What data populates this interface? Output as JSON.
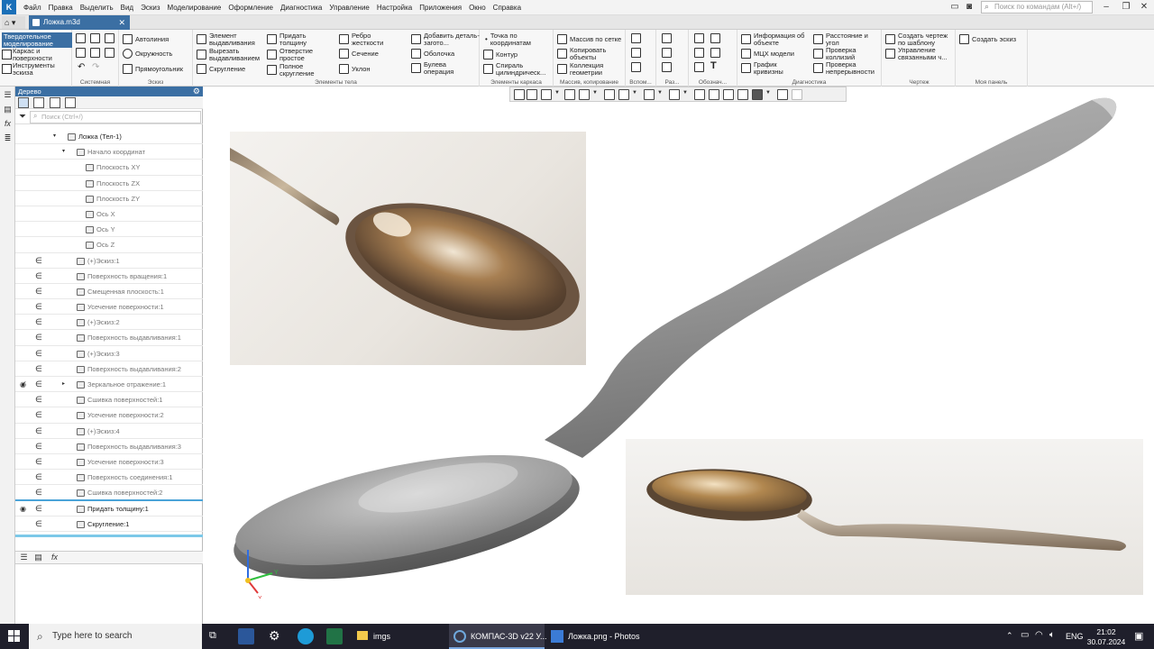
{
  "menu": [
    "Файл",
    "Правка",
    "Выделить",
    "Вид",
    "Эскиз",
    "Моделирование",
    "Оформление",
    "Диагностика",
    "Управление",
    "Настройка",
    "Приложения",
    "Окно",
    "Справка"
  ],
  "command_search_placeholder": "Поиск по командам (Alt+/)",
  "doc_tab": "Ложка.m3d",
  "ribbon": {
    "modes": [
      "Твердотельное моделирование",
      "Каркас и поверхности",
      "Инструменты эскиза"
    ],
    "system": {
      "label": "Системная"
    },
    "sketch": {
      "label": "Эскиз",
      "items": [
        "Автолиния",
        "Окружность",
        "Прямоугольник"
      ]
    },
    "body": {
      "label": "Элементы тела",
      "items": [
        "Элемент выдавливания",
        "Вырезать выдавливанием",
        "Скругление",
        "Придать толщину",
        "Отверстие простое",
        "Полное скругление",
        "Ребро жесткости",
        "Сечение",
        "Уклон",
        "Добавить деталь-загото...",
        "Оболочка",
        "Булева операция"
      ]
    },
    "frame": {
      "label": "Элементы каркаса",
      "items": [
        "Точка по координатам",
        "Контур",
        "Спираль цилиндрическ..."
      ]
    },
    "arrays": {
      "label": "Массив, копирование",
      "items": [
        "Массив по сетке",
        "Копировать объекты",
        "Коллекция геометрии"
      ]
    },
    "aux": {
      "label": "Вспом..."
    },
    "sizes": {
      "label": "Раз..."
    },
    "marks": {
      "label": "Обознач..."
    },
    "diag": {
      "label": "Диагностика",
      "items": [
        "Информация об объекте",
        "МЦХ модели",
        "График кривизны",
        "Расстояние и угол",
        "Проверка коллизий",
        "Проверка непрерывности"
      ]
    },
    "drawing": {
      "label": "Чертеж",
      "items": [
        "Создать чертеж по шаблону",
        "Управление связанными ч..."
      ]
    },
    "mypanel": {
      "label": "Моя панель",
      "items": [
        "Создать эскиз"
      ]
    }
  },
  "tree": {
    "title": "Дерево",
    "search_placeholder": "Поиск (Ctrl+/)",
    "rows": [
      {
        "label": "Ложка (Тел-1)",
        "indent": 0,
        "arrow": "▾",
        "faded": false,
        "eye": "",
        "dep": ""
      },
      {
        "label": "Начало координат",
        "indent": 1,
        "arrow": "▾",
        "faded": true,
        "eye": "",
        "dep": ""
      },
      {
        "label": "Плоскость XY",
        "indent": 2,
        "arrow": "",
        "faded": true,
        "eye": "",
        "dep": ""
      },
      {
        "label": "Плоскость ZX",
        "indent": 2,
        "arrow": "",
        "faded": true,
        "eye": "",
        "dep": ""
      },
      {
        "label": "Плоскость ZY",
        "indent": 2,
        "arrow": "",
        "faded": true,
        "eye": "",
        "dep": ""
      },
      {
        "label": "Ось X",
        "indent": 2,
        "arrow": "",
        "faded": true,
        "eye": "",
        "dep": ""
      },
      {
        "label": "Ось Y",
        "indent": 2,
        "arrow": "",
        "faded": true,
        "eye": "",
        "dep": ""
      },
      {
        "label": "Ось Z",
        "indent": 2,
        "arrow": "",
        "faded": true,
        "eye": "",
        "dep": ""
      },
      {
        "label": "(+)Эскиз:1",
        "indent": 1,
        "arrow": "",
        "faded": true,
        "eye": "",
        "dep": "∈"
      },
      {
        "label": "Поверхность вращения:1",
        "indent": 1,
        "arrow": "",
        "faded": true,
        "eye": "",
        "dep": "∈"
      },
      {
        "label": "Смещенная плоскость:1",
        "indent": 1,
        "arrow": "",
        "faded": true,
        "eye": "",
        "dep": "∈"
      },
      {
        "label": "Усечение поверхности:1",
        "indent": 1,
        "arrow": "",
        "faded": true,
        "eye": "",
        "dep": "∈"
      },
      {
        "label": "(+)Эскиз:2",
        "indent": 1,
        "arrow": "",
        "faded": true,
        "eye": "",
        "dep": "∈"
      },
      {
        "label": "Поверхность выдавливания:1",
        "indent": 1,
        "arrow": "",
        "faded": true,
        "eye": "",
        "dep": "∈"
      },
      {
        "label": "(+)Эскиз:3",
        "indent": 1,
        "arrow": "",
        "faded": true,
        "eye": "",
        "dep": "∈"
      },
      {
        "label": "Поверхность выдавливания:2",
        "indent": 1,
        "arrow": "",
        "faded": true,
        "eye": "",
        "dep": "∈"
      },
      {
        "label": "Зеркальное отражение:1",
        "indent": 1,
        "arrow": "▸",
        "faded": true,
        "eye": "◉̸",
        "dep": "∈"
      },
      {
        "label": "Сшивка поверхностей:1",
        "indent": 1,
        "arrow": "",
        "faded": true,
        "eye": "",
        "dep": "∈"
      },
      {
        "label": "Усечение поверхности:2",
        "indent": 1,
        "arrow": "",
        "faded": true,
        "eye": "",
        "dep": "∈"
      },
      {
        "label": "(+)Эскиз:4",
        "indent": 1,
        "arrow": "",
        "faded": true,
        "eye": "",
        "dep": "∈"
      },
      {
        "label": "Поверхность выдавливания:3",
        "indent": 1,
        "arrow": "",
        "faded": true,
        "eye": "",
        "dep": "∈"
      },
      {
        "label": "Усечение поверхности:3",
        "indent": 1,
        "arrow": "",
        "faded": true,
        "eye": "",
        "dep": "∈"
      },
      {
        "label": "Поверхность соединения:1",
        "indent": 1,
        "arrow": "",
        "faded": true,
        "eye": "",
        "dep": "∈"
      },
      {
        "label": "Сшивка поверхностей:2",
        "indent": 1,
        "arrow": "",
        "faded": true,
        "eye": "",
        "dep": "∈"
      },
      {
        "label": "Придать толщину:1",
        "indent": 1,
        "arrow": "",
        "faded": false,
        "eye": "◉",
        "dep": "∈"
      },
      {
        "label": "Скругление:1",
        "indent": 1,
        "arrow": "",
        "faded": false,
        "eye": "",
        "dep": "∈"
      }
    ]
  },
  "axes": {
    "y": "Y",
    "x": "X"
  },
  "taskbar": {
    "search_placeholder": "Type here to search",
    "tasks": [
      "imgs",
      "КОМПАС-3D v22 У...",
      "Ложка.png - Photos"
    ],
    "lang": "ENG",
    "time": "21:02",
    "date": "30.07.2024"
  }
}
